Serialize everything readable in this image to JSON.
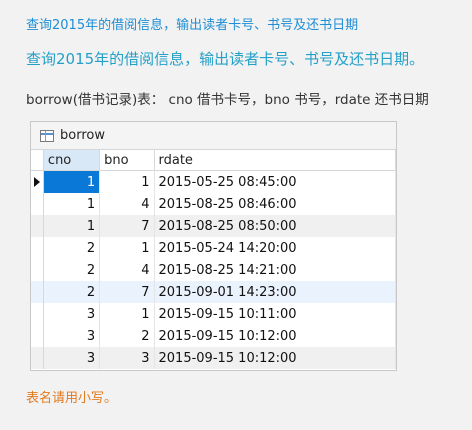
{
  "page": {
    "top_title": "查询2015年的借阅信息，输出读者卡号、书号及还书日期",
    "heading": "查询2015年的借阅信息，输出读者卡号、书号及还书日期。",
    "description": "borrow(借书记录)表： cno 借书卡号，bno 书号，rdate 还书日期",
    "note": "表名请用小写。"
  },
  "grid": {
    "window_title": "borrow",
    "columns": [
      "cno",
      "bno",
      "rdate"
    ],
    "rows": [
      [
        "1",
        "1",
        "2015-05-25 08:45:00"
      ],
      [
        "1",
        "4",
        "2015-08-25 08:46:00"
      ],
      [
        "1",
        "7",
        "2015-08-25 08:50:00"
      ],
      [
        "2",
        "1",
        "2015-05-24 14:20:00"
      ],
      [
        "2",
        "4",
        "2015-08-25 14:21:00"
      ],
      [
        "2",
        "7",
        "2015-09-01 14:23:00"
      ],
      [
        "3",
        "1",
        "2015-09-15 10:11:00"
      ],
      [
        "3",
        "2",
        "2015-09-15 10:12:00"
      ],
      [
        "3",
        "3",
        "2015-09-15 10:12:00"
      ]
    ]
  }
}
